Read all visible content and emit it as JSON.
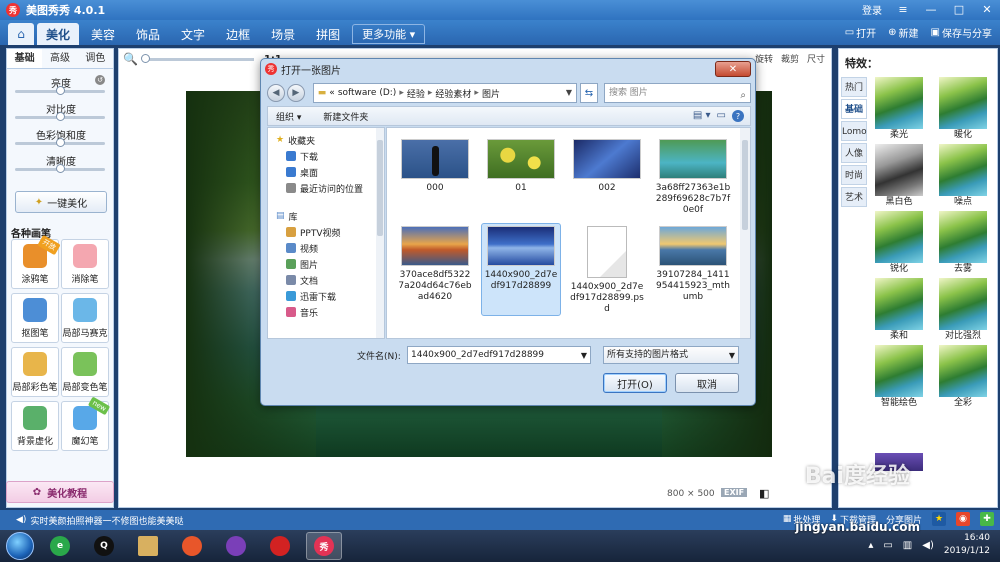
{
  "app": {
    "title": "美图秀秀 4.0.1",
    "logo_text": "秀",
    "login": "登录"
  },
  "window_controls": {
    "menu": "≡",
    "minimize": "—",
    "maximize": "□",
    "close": "✕"
  },
  "toolbar": {
    "home": "⌂",
    "tabs": [
      "美化",
      "美容",
      "饰品",
      "文字",
      "边框",
      "场景",
      "拼图"
    ],
    "more": "更多功能 ▾",
    "open": "打开",
    "new": "新建",
    "save_share": "保存与分享"
  },
  "left_panel": {
    "tabs": [
      "基础",
      "高级",
      "调色"
    ],
    "sliders": [
      {
        "label": "亮度",
        "value": 0.5
      },
      {
        "label": "对比度",
        "value": 0.5
      },
      {
        "label": "色彩饱和度",
        "value": 0.5
      },
      {
        "label": "清晰度",
        "value": 0.5
      }
    ],
    "auto_button": "一键美化",
    "brush_title": "各种画笔",
    "brushes": [
      {
        "label": "涂鸦笔",
        "badge": "开放",
        "color": "#e98f2a"
      },
      {
        "label": "消除笔",
        "badge": "",
        "color": "#f4a7b0"
      },
      {
        "label": "抠图笔",
        "badge": "",
        "color": "#4d8ed6"
      },
      {
        "label": "局部马赛克",
        "badge": "",
        "color": "#6bb7e8"
      },
      {
        "label": "局部彩色笔",
        "badge": "",
        "color": "#e8b54a"
      },
      {
        "label": "局部变色笔",
        "badge": "",
        "color": "#7ac25a"
      },
      {
        "label": "背景虚化",
        "badge": "",
        "color": "#5ab06a"
      },
      {
        "label": "魔幻笔",
        "badge": "new",
        "color": "#58a8e8"
      }
    ],
    "tutorial": "美化教程"
  },
  "canvas": {
    "zoom_value": "1:1",
    "zoom_fraction": 0.0,
    "right_tools": [
      "旋转",
      "裁剪",
      "尺寸"
    ],
    "image_size": "800 × 500",
    "exif": "EXIF"
  },
  "right_panel": {
    "title": "特效：",
    "tabs": [
      "热门",
      "基础",
      "Lomo",
      "人像",
      "时尚",
      "艺术"
    ],
    "active_tab": 1,
    "effects": [
      "柔光",
      "暖化",
      "黑白色",
      "噪点",
      "锐化",
      "去雾",
      "柔和",
      "对比强烈",
      "智能绘色",
      "全彩"
    ]
  },
  "statusbar": {
    "message": "实时美颜拍照神器一不修图也能美美哒",
    "batch": "批处理",
    "download": "下载管理",
    "share": "分享图片"
  },
  "taskbar": {
    "time": "16:40",
    "date": "2019/1/12",
    "app_labels": [
      "e",
      "Q",
      "",
      "",
      "",
      "",
      "秀"
    ],
    "app_colors": [
      "#2aa84a",
      "#111111",
      "#d8b060",
      "#e8562a",
      "#7a3fb8",
      "#d22222",
      "#e33355"
    ]
  },
  "watermark": {
    "brand": "Bai度经验",
    "url": "jingyan.baidu.com"
  },
  "dialog": {
    "title": "打开一张图片",
    "close": "✕",
    "breadcrumb": [
      "«",
      "software (D:)",
      "经验",
      "经验素材",
      "图片"
    ],
    "search_placeholder": "搜索 图片",
    "organize": "组织 ▾",
    "new_folder": "新建文件夹",
    "nav": {
      "favorites": "收藏夹",
      "favorites_items": [
        "下载",
        "桌面",
        "最近访问的位置"
      ],
      "library": "库",
      "library_items": [
        "PPTV视频",
        "视频",
        "图片",
        "文档",
        "迅雷下载",
        "音乐"
      ]
    },
    "files": [
      {
        "name": "000",
        "thumb": "t-000"
      },
      {
        "name": "01",
        "thumb": "t-01"
      },
      {
        "name": "002",
        "thumb": "t-002"
      },
      {
        "name": "3a68ff27363e1b289f69628c7b7f0e0f",
        "thumb": "t-3a6"
      },
      {
        "name": "370ace8df53227a204d64c76ebad4620",
        "thumb": "t-370"
      },
      {
        "name": "1440x900_2d7edf917d28899",
        "thumb": "t-1440",
        "selected": true
      },
      {
        "name": "1440x900_2d7edf917d28899.psd",
        "thumb": "t-psd"
      },
      {
        "name": "39107284_1411954415923_mthumb",
        "thumb": "t-391"
      }
    ],
    "filename_label": "文件名(N):",
    "filename_value": "1440x900_2d7edf917d28899",
    "filetype_value": "所有支持的图片格式",
    "open_button": "打开(O)",
    "cancel_button": "取消"
  }
}
